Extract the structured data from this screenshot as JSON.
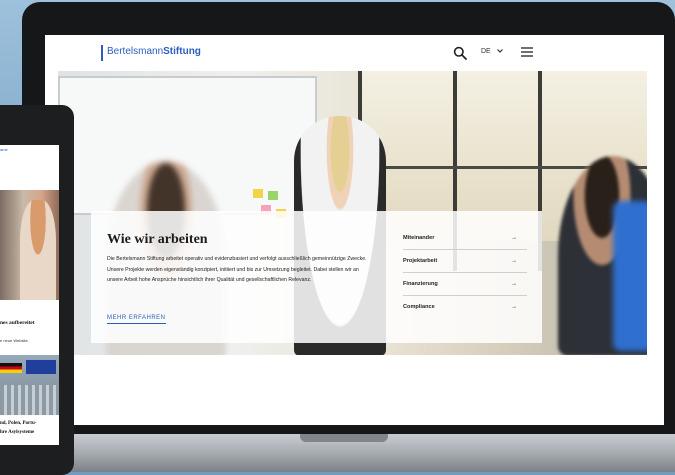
{
  "site": {
    "logo_light": "Bertelsmann",
    "logo_bold": "Stiftung",
    "language": "DE"
  },
  "panel": {
    "title": "Wie wir arbeiten",
    "text": "Die Bertelsmann Stiftung arbeitet operativ und evidenzbasiert und verfolgt ausschließlich gemeinnützige Zwecke. Unsere Projekte werden eigenständig konzipiert, initiiert und bis zur Umsetzung begleitet. Dabei stellen wir an unsere Arbeit hohe Ansprüche hinsichtlich ihrer Qualität und gesellschaftlichen Relevanz.",
    "link": "MEHR ERFAHREN",
    "nav": [
      {
        "label": "Miteinander",
        "arrow": "→"
      },
      {
        "label": "Projektarbeit",
        "arrow": "→"
      },
      {
        "label": "Finanzierung",
        "arrow": "→"
      },
      {
        "label": "Compliance",
        "arrow": "→"
      }
    ]
  },
  "tablet": {
    "link": "ame",
    "heading1": "nes aufbereitet",
    "text1": "e neue Website.",
    "heading2_line1": "nd, Polen, Portu-",
    "heading2_line2": "hre Asylsysteme"
  },
  "colors": {
    "brand_blue": "#2a5fbf"
  }
}
